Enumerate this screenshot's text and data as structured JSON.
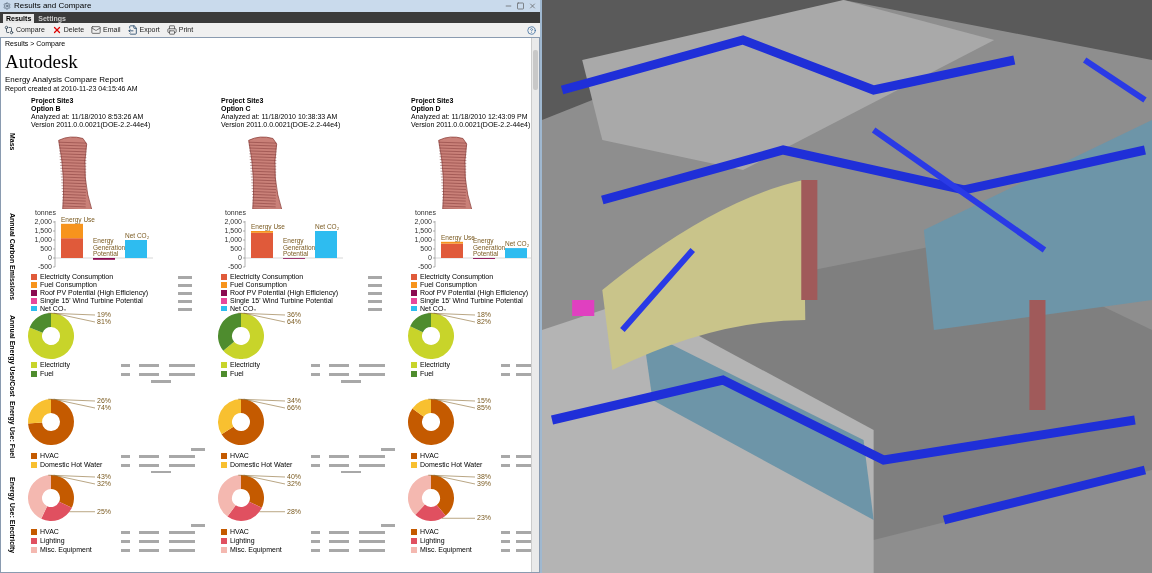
{
  "window": {
    "title": "Results and Compare"
  },
  "tabs": [
    {
      "label": "Results",
      "selected": true
    },
    {
      "label": "Settings",
      "selected": false
    }
  ],
  "toolbar": [
    {
      "kind": "compare",
      "label": "Compare"
    },
    {
      "kind": "delete",
      "label": "Delete"
    },
    {
      "kind": "email",
      "label": "Email"
    },
    {
      "kind": "export",
      "label": "Export"
    },
    {
      "kind": "print",
      "label": "Print"
    }
  ],
  "breadcrumb": "Results > Compare",
  "report": {
    "logo": "Autodesk",
    "title": "Energy Analysis Compare Report",
    "created": "Report created at 2010-11-23 04:15:46 AM"
  },
  "sections": [
    "Mass",
    "Annual Carbon Emissions",
    "Annual Energy Use/Cost",
    "Energy Use: Fuel",
    "Energy Use: Electricity"
  ],
  "options": [
    {
      "project": "Project Site3",
      "option": "Option B",
      "analyzed": "Analyzed at: 11/18/2010 8:53:26 AM",
      "version": "Version 2011.0.0.0021(DOE-2.2-44e4)",
      "carbon": {
        "chart_data": {
          "type": "bar",
          "stacked": true,
          "ylabel": "tonnes",
          "categories": [
            "Energy Use",
            "Energy Generation Potential",
            "Net CO₂"
          ],
          "ylim": [
            -500,
            2000
          ],
          "yticks": [
            {
              "value": -500,
              "label": "-500"
            },
            {
              "value": 0,
              "label": "0"
            },
            {
              "value": 500,
              "label": "500"
            },
            {
              "value": 1000,
              "label": "1,000"
            },
            {
              "value": 1500,
              "label": "1,500"
            },
            {
              "value": 2000,
              "label": "2,000"
            }
          ],
          "series": [
            {
              "name": "Electricity Consumption",
              "color": "#e05a3a",
              "values": [
                1100,
                null,
                null
              ]
            },
            {
              "name": "Fuel Consumption",
              "color": "#f7941d",
              "values": [
                800,
                null,
                null
              ]
            },
            {
              "name": "Roof PV Potential (High Efficiency)",
              "color": "#8b0a50",
              "values": [
                null,
                -100,
                null
              ]
            },
            {
              "name": "Single 15' Wind Turbine Potential",
              "color": "#e8479b",
              "values": [
                null,
                0,
                null
              ]
            },
            {
              "name": "Net CO₂",
              "color": "#2ebcf0",
              "values": [
                null,
                null,
                1000
              ]
            }
          ]
        }
      },
      "cost": {
        "chart_data": {
          "type": "donut",
          "categories": [
            "Electricity",
            "Fuel"
          ],
          "colors": [
            "#c8d42a",
            "#4e8c2e"
          ],
          "values": [
            81,
            19
          ],
          "value_labels": [
            "81%",
            "19%"
          ]
        }
      },
      "fuel": {
        "chart_data": {
          "type": "donut",
          "categories": [
            "HVAC",
            "Domestic Hot Water"
          ],
          "colors": [
            "#c45a00",
            "#f8c030"
          ],
          "values": [
            74,
            26
          ],
          "value_labels": [
            "74%",
            "26%"
          ]
        }
      },
      "electricity": {
        "chart_data": {
          "type": "donut",
          "categories": [
            "HVAC",
            "Lighting",
            "Misc. Equipment"
          ],
          "colors": [
            "#c45a00",
            "#e05060",
            "#f4b8b0"
          ],
          "values": [
            32,
            25,
            43
          ],
          "value_labels": [
            "32%",
            "25%",
            "43%"
          ]
        }
      }
    },
    {
      "project": "Project Site3",
      "option": "Option C",
      "analyzed": "Analyzed at: 11/18/2010 10:38:33 AM",
      "version": "Version 2011.0.0.0021(DOE-2.2-44e4)",
      "carbon": {
        "chart_data": {
          "type": "bar",
          "stacked": true,
          "ylabel": "tonnes",
          "categories": [
            "Energy Use",
            "Energy Generation Potential",
            "Net CO₂"
          ],
          "ylim": [
            -500,
            2000
          ],
          "yticks": [
            {
              "value": -500,
              "label": "-500"
            },
            {
              "value": 0,
              "label": "0"
            },
            {
              "value": 500,
              "label": "500"
            },
            {
              "value": 1000,
              "label": "1,000"
            },
            {
              "value": 1500,
              "label": "1,500"
            },
            {
              "value": 2000,
              "label": "2,000"
            }
          ],
          "series": [
            {
              "name": "Electricity Consumption",
              "color": "#e05a3a",
              "values": [
                1400,
                null,
                null
              ]
            },
            {
              "name": "Fuel Consumption",
              "color": "#f7941d",
              "values": [
                100,
                null,
                null
              ]
            },
            {
              "name": "Roof PV Potential (High Efficiency)",
              "color": "#8b0a50",
              "values": [
                null,
                -30,
                null
              ]
            },
            {
              "name": "Single 15' Wind Turbine Potential",
              "color": "#e8479b",
              "values": [
                null,
                0,
                null
              ]
            },
            {
              "name": "Net CO₂",
              "color": "#2ebcf0",
              "values": [
                null,
                null,
                1500
              ]
            }
          ]
        }
      },
      "cost": {
        "chart_data": {
          "type": "donut",
          "categories": [
            "Electricity",
            "Fuel"
          ],
          "colors": [
            "#c8d42a",
            "#4e8c2e"
          ],
          "values": [
            64,
            36
          ],
          "value_labels": [
            "64%",
            "36%"
          ]
        }
      },
      "fuel": {
        "chart_data": {
          "type": "donut",
          "categories": [
            "HVAC",
            "Domestic Hot Water"
          ],
          "colors": [
            "#c45a00",
            "#f8c030"
          ],
          "values": [
            66,
            34
          ],
          "value_labels": [
            "66%",
            "34%"
          ]
        }
      },
      "electricity": {
        "chart_data": {
          "type": "donut",
          "categories": [
            "HVAC",
            "Lighting",
            "Misc. Equipment"
          ],
          "colors": [
            "#c45a00",
            "#e05060",
            "#f4b8b0"
          ],
          "values": [
            32,
            28,
            40
          ],
          "value_labels": [
            "32%",
            "28%",
            "40%"
          ]
        }
      }
    },
    {
      "project": "Project Site3",
      "option": "Option D",
      "analyzed": "Analyzed at: 11/18/2010 12:43:09 PM",
      "version": "Version 2011.0.0.0021(DOE-2.2-44e4)",
      "carbon": {
        "chart_data": {
          "type": "bar",
          "stacked": true,
          "ylabel": "tonnes",
          "categories": [
            "Energy Use",
            "Energy Generation Potential",
            "Net CO₂"
          ],
          "ylim": [
            -500,
            2000
          ],
          "yticks": [
            {
              "value": -500,
              "label": "-500"
            },
            {
              "value": 0,
              "label": "0"
            },
            {
              "value": 500,
              "label": "500"
            },
            {
              "value": 1000,
              "label": "1,000"
            },
            {
              "value": 1500,
              "label": "1,500"
            },
            {
              "value": 2000,
              "label": "2,000"
            }
          ],
          "series": [
            {
              "name": "Electricity Consumption",
              "color": "#e05a3a",
              "values": [
                800,
                null,
                null
              ]
            },
            {
              "name": "Fuel Consumption",
              "color": "#f7941d",
              "values": [
                100,
                null,
                null
              ]
            },
            {
              "name": "Roof PV Potential (High Efficiency)",
              "color": "#8b0a50",
              "values": [
                null,
                -50,
                null
              ]
            },
            {
              "name": "Single 15' Wind Turbine Potential",
              "color": "#e8479b",
              "values": [
                null,
                0,
                null
              ]
            },
            {
              "name": "Net CO₂",
              "color": "#2ebcf0",
              "values": [
                null,
                null,
                550
              ]
            }
          ]
        }
      },
      "cost": {
        "chart_data": {
          "type": "donut",
          "categories": [
            "Electricity",
            "Fuel"
          ],
          "colors": [
            "#c8d42a",
            "#4e8c2e"
          ],
          "values": [
            82,
            18
          ],
          "value_labels": [
            "82%",
            "18%"
          ]
        }
      },
      "fuel": {
        "chart_data": {
          "type": "donut",
          "categories": [
            "HVAC",
            "Domestic Hot Water"
          ],
          "colors": [
            "#c45a00",
            "#f8c030"
          ],
          "values": [
            85,
            15
          ],
          "value_labels": [
            "85%",
            "15%"
          ]
        }
      },
      "electricity": {
        "chart_data": {
          "type": "donut",
          "categories": [
            "HVAC",
            "Lighting",
            "Misc. Equipment"
          ],
          "colors": [
            "#c45a00",
            "#e05060",
            "#f4b8b0"
          ],
          "values": [
            39,
            23,
            38
          ],
          "value_labels": [
            "39%",
            "23%",
            "38%"
          ]
        }
      }
    }
  ]
}
